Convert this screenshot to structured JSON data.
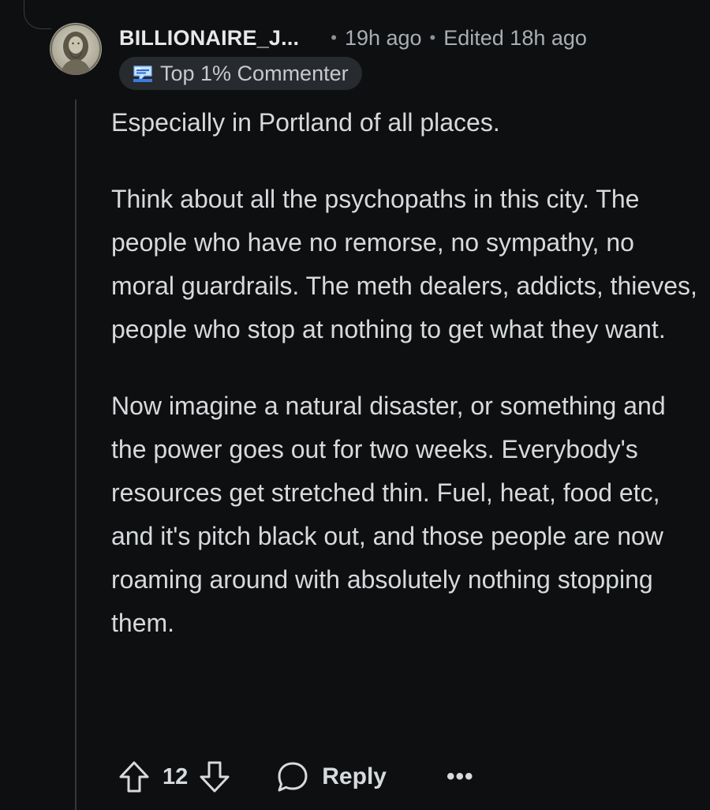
{
  "comment": {
    "username": "BILLIONAIRE_J...",
    "time_posted": "19h ago",
    "edited": "Edited 18h ago",
    "separator": "•",
    "badge": {
      "icon": "commenter-badge-icon",
      "label": "Top 1% Commenter"
    },
    "avatar_icon": "avatar-portrait",
    "paragraphs": [
      "Especially in Portland of all places.",
      "Think about all the psychopaths in this city. The people who have no remorse, no sympathy, no moral guardrails. The meth dealers, addicts, thieves, people who stop at nothing to get what they want.",
      "Now imagine a natural disaster, or something and the power goes out for two weeks. Everybody's resources get stretched thin. Fuel, heat, food etc, and it's pitch black out, and those people are now roaming around with absolutely nothing stopping them."
    ]
  },
  "actions": {
    "vote_count": "12",
    "reply_label": "Reply",
    "more_label": "•••",
    "upvote_icon": "upvote-arrow-icon",
    "downvote_icon": "downvote-arrow-icon",
    "reply_icon": "speech-bubble-icon",
    "more_icon": "ellipsis-icon"
  },
  "colors": {
    "background": "#0e0f11",
    "text": "#d7dadc",
    "meta_text": "#a8aeb4",
    "badge_bg": "#272a2e"
  }
}
